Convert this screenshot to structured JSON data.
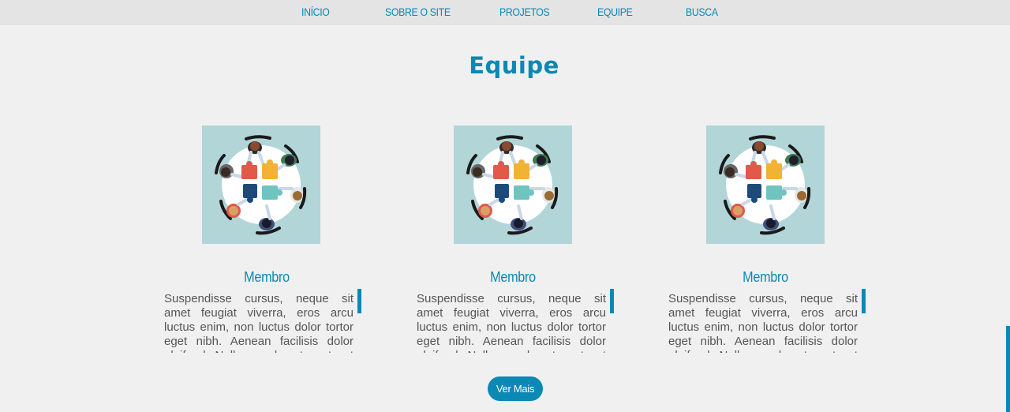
{
  "nav": {
    "items": [
      "INÍCIO",
      "SOBRE O SITE",
      "PROJETOS",
      "EQUIPE",
      "BUSCA"
    ]
  },
  "section": {
    "title": "Equipe"
  },
  "team": [
    {
      "name": "Membro",
      "text": "Suspendisse cursus, neque sit amet feugiat viverra, eros arcu luctus enim, non luctus dolor tortor eget nibh. Aenean facilisis dolor eleifend. Nullam sed metus at est elementum tincidunt.",
      "image_icon": "team-puzzle-illustration"
    },
    {
      "name": "Membro",
      "text": "Suspendisse cursus, neque sit amet feugiat viverra, eros arcu luctus enim, non luctus dolor tortor eget nibh. Aenean facilisis dolor eleifend. Nullam sed metus at est elementum tincidunt.",
      "image_icon": "team-puzzle-illustration"
    },
    {
      "name": "Membro",
      "text": "Suspendisse cursus, neque sit amet feugiat viverra, eros arcu luctus enim, non luctus dolor tortor eget nibh. Aenean facilisis dolor eleifend. Nullam sed metus at est elementum tincidunt.",
      "image_icon": "team-puzzle-illustration"
    }
  ],
  "more_button": {
    "label": "Ver Mais"
  },
  "colors": {
    "accent": "#0b88b3",
    "background": "#f0f0f0",
    "nav_background": "#e4e4e4",
    "image_background": "#b2d5d8"
  }
}
